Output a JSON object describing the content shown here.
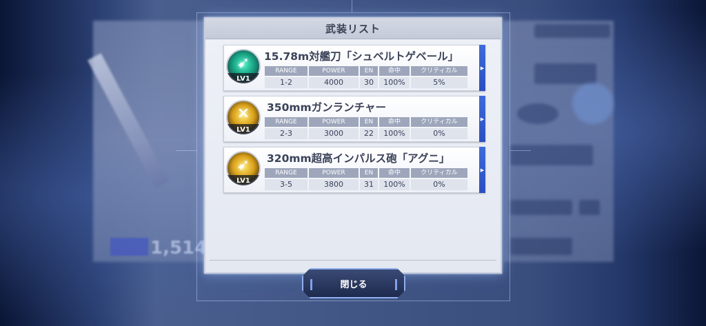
{
  "dialog": {
    "title": "武装リスト",
    "close_label": "閉じる"
  },
  "background": {
    "number": "1,514"
  },
  "stat_headers": [
    "RANGE",
    "POWER",
    "EN",
    "命中",
    "クリティカル"
  ],
  "weapons": [
    {
      "name": "15.78m対艦刀「シュベルトゲベール」",
      "level": "LV1",
      "icon": "sword-slash-icon",
      "range": "1-2",
      "power": "4000",
      "en": "30",
      "accuracy": "100%",
      "critical": "5%"
    },
    {
      "name": "350mmガンランチャー",
      "level": "LV1",
      "icon": "explosion-icon",
      "range": "2-3",
      "power": "3000",
      "en": "22",
      "accuracy": "100%",
      "critical": "0%"
    },
    {
      "name": "320mm超高インパルス砲「アグニ」",
      "level": "LV1",
      "icon": "beam-shot-icon",
      "range": "3-5",
      "power": "3800",
      "en": "31",
      "accuracy": "100%",
      "critical": "0%"
    }
  ],
  "colors": {
    "accent": "#2f5bcc",
    "panel": "#e9ecf3",
    "header_cell": "#9da6bb"
  }
}
